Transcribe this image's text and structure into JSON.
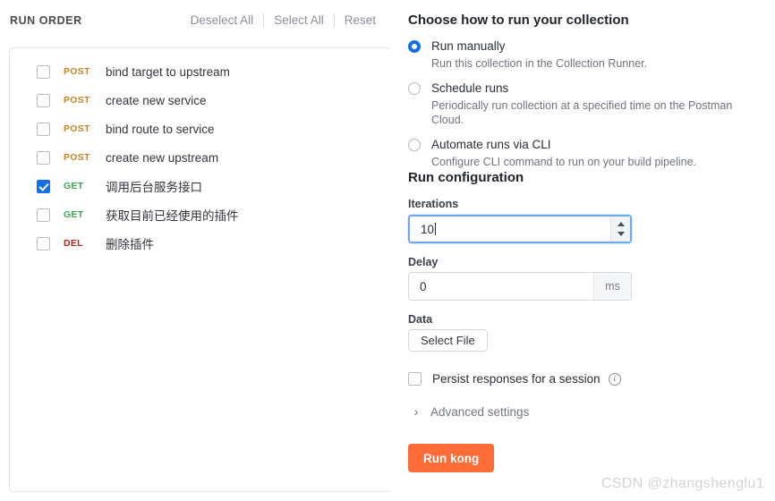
{
  "left": {
    "title": "RUN ORDER",
    "actions": [
      {
        "label": "Deselect All"
      },
      {
        "label": "Select All"
      },
      {
        "label": "Reset"
      }
    ],
    "requests": [
      {
        "method": "POST",
        "name": "bind target to upstream",
        "checked": false
      },
      {
        "method": "POST",
        "name": "create new service",
        "checked": false
      },
      {
        "method": "POST",
        "name": "bind route to service",
        "checked": false
      },
      {
        "method": "POST",
        "name": "create new upstream",
        "checked": false
      },
      {
        "method": "GET",
        "name": "调用后台服务接口",
        "checked": true
      },
      {
        "method": "GET",
        "name": "获取目前已经使用的插件",
        "checked": false
      },
      {
        "method": "DEL",
        "name": "删除插件",
        "checked": false
      }
    ]
  },
  "right": {
    "choose_title": "Choose how to run your collection",
    "run_modes": [
      {
        "label": "Run manually",
        "desc": "Run this collection in the Collection Runner.",
        "selected": true
      },
      {
        "label": "Schedule runs",
        "desc": "Periodically run collection at a specified time on the Postman Cloud.",
        "selected": false
      },
      {
        "label": "Automate runs via CLI",
        "desc": "Configure CLI command to run on your build pipeline.",
        "selected": false
      }
    ],
    "run_config_title": "Run configuration",
    "iterations": {
      "label": "Iterations",
      "value": "10"
    },
    "delay": {
      "label": "Delay",
      "value": "0",
      "unit": "ms"
    },
    "data": {
      "label": "Data",
      "button": "Select File"
    },
    "persist": {
      "label": "Persist responses for a session",
      "checked": false,
      "info": "i"
    },
    "advanced": {
      "label": "Advanced settings",
      "chevron": "›"
    },
    "run_button": "Run kong"
  },
  "watermark": "CSDN @zhangshenglu1",
  "colors": {
    "accent_orange": "#fb6c36",
    "accent_blue": "#1270e8",
    "method_post": "#c1892a",
    "method_get": "#3aa35a",
    "method_del": "#b4261d"
  }
}
